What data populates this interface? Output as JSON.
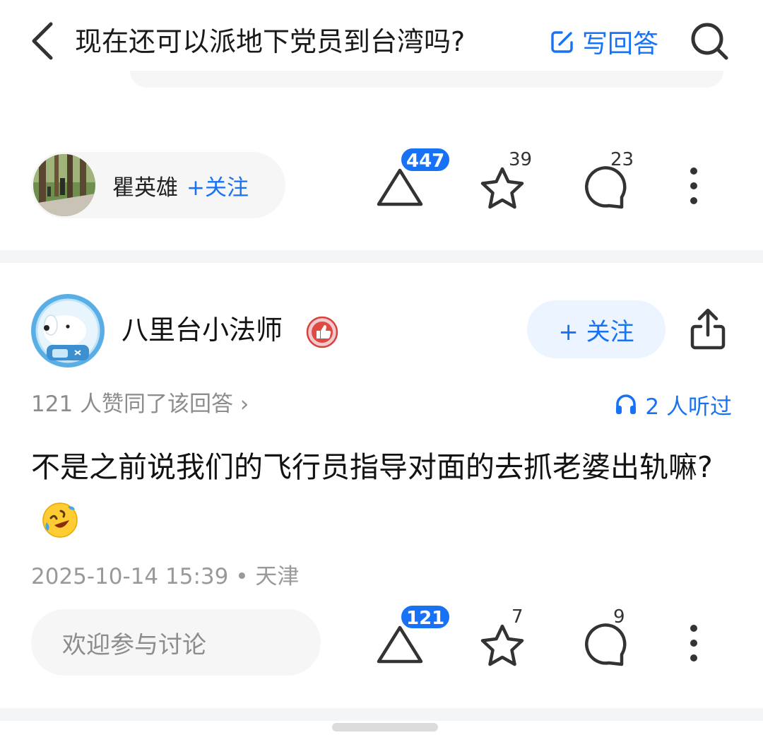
{
  "header": {
    "question_title": "现在还可以派地下党员到台湾吗?",
    "write_answer_label": "写回答",
    "accent_color": "#1772f6"
  },
  "previous_answer": {
    "author_name": "瞿英雄",
    "follow_label": "+关注",
    "vote_count": "447",
    "favorite_count": "39",
    "comment_count": "23"
  },
  "answer": {
    "author_name": "八里台小法师",
    "follow_label": "+ 关注",
    "agree_text": "121 人赞同了该回答 ›",
    "listened_text": "2 人听过",
    "content": "不是之前说我们的飞行员指导对面的去抓老婆出轨嘛?",
    "content_emoji": "rolling-on-floor-laughing-emoji",
    "meta": "2025-10-14 15:39 • 天津",
    "comment_placeholder": "欢迎参与讨论",
    "vote_count": "121",
    "favorite_count": "7",
    "comment_count": "9"
  },
  "icons": {
    "back": "chevron-left-icon",
    "search": "search-icon",
    "write": "edit-icon",
    "upvote": "triangle-upvote-icon",
    "favorite": "star-icon",
    "comment": "comment-bubble-icon",
    "more": "vertical-dots-icon",
    "share": "share-icon",
    "headphone": "headphone-icon",
    "badge": "thumbs-up-badge-icon"
  }
}
